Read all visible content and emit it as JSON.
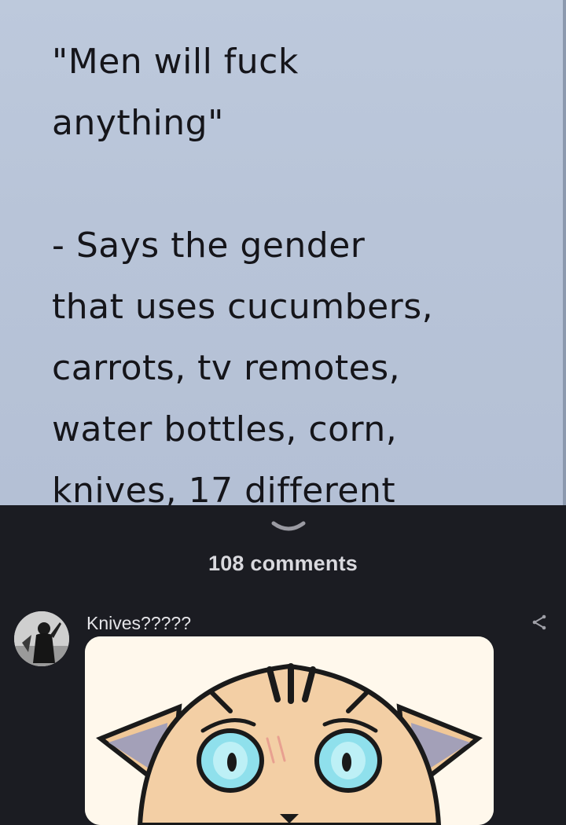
{
  "meme": {
    "lines_quote": [
      "\"Men will fuck",
      "anything\""
    ],
    "lines_body": [
      "- Says the gender",
      "that uses cucumbers,",
      "carrots, tv remotes,",
      "water bottles, corn,",
      "knives, 17 different"
    ]
  },
  "comments_header": {
    "count_label": "108 comments",
    "collapse_icon": "chevron-down-icon"
  },
  "comment": {
    "text": "Knives?????",
    "avatar_icon": "avatar-figure",
    "share_icon": "share-icon",
    "sticker": "crying-cat-sticker"
  },
  "colors": {
    "background": "#1b1c22",
    "meme_bg": "#b8c4d8",
    "text_light": "#e4e4e8"
  }
}
